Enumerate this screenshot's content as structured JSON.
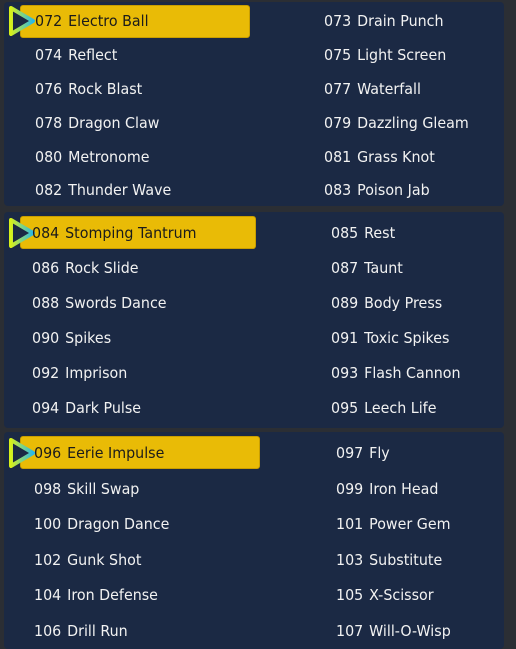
{
  "panels": [
    {
      "items": [
        {
          "num": "072",
          "name": "Electro Ball",
          "selected": true
        },
        {
          "num": "073",
          "name": "Drain Punch"
        },
        {
          "num": "074",
          "name": "Reflect"
        },
        {
          "num": "075",
          "name": "Light Screen"
        },
        {
          "num": "076",
          "name": "Rock Blast"
        },
        {
          "num": "077",
          "name": "Waterfall"
        },
        {
          "num": "078",
          "name": "Dragon Claw"
        },
        {
          "num": "079",
          "name": "Dazzling Gleam"
        },
        {
          "num": "080",
          "name": "Metronome"
        },
        {
          "num": "081",
          "name": "Grass Knot"
        },
        {
          "num": "082",
          "name": "Thunder Wave"
        },
        {
          "num": "083",
          "name": "Poison Jab"
        }
      ]
    },
    {
      "items": [
        {
          "num": "084",
          "name": "Stomping Tantrum",
          "selected": true
        },
        {
          "num": "085",
          "name": "Rest"
        },
        {
          "num": "086",
          "name": "Rock Slide"
        },
        {
          "num": "087",
          "name": "Taunt"
        },
        {
          "num": "088",
          "name": "Swords Dance"
        },
        {
          "num": "089",
          "name": "Body Press"
        },
        {
          "num": "090",
          "name": "Spikes"
        },
        {
          "num": "091",
          "name": "Toxic Spikes"
        },
        {
          "num": "092",
          "name": "Imprison"
        },
        {
          "num": "093",
          "name": "Flash Cannon"
        },
        {
          "num": "094",
          "name": "Dark Pulse"
        },
        {
          "num": "095",
          "name": "Leech Life"
        }
      ]
    },
    {
      "items": [
        {
          "num": "096",
          "name": "Eerie Impulse",
          "selected": true
        },
        {
          "num": "097",
          "name": "Fly"
        },
        {
          "num": "098",
          "name": "Skill Swap"
        },
        {
          "num": "099",
          "name": "Iron Head"
        },
        {
          "num": "100",
          "name": "Dragon Dance"
        },
        {
          "num": "101",
          "name": "Power Gem"
        },
        {
          "num": "102",
          "name": "Gunk Shot"
        },
        {
          "num": "103",
          "name": "Substitute"
        },
        {
          "num": "104",
          "name": "Iron Defense"
        },
        {
          "num": "105",
          "name": "X-Scissor"
        },
        {
          "num": "106",
          "name": "Drill Run"
        },
        {
          "num": "107",
          "name": "Will-O-Wisp"
        }
      ]
    }
  ],
  "colors": {
    "panel": "#1b2944",
    "highlight": "#e9bb06",
    "background": "#2b2e34"
  },
  "cursor_icon": "triangle-pointer-icon"
}
